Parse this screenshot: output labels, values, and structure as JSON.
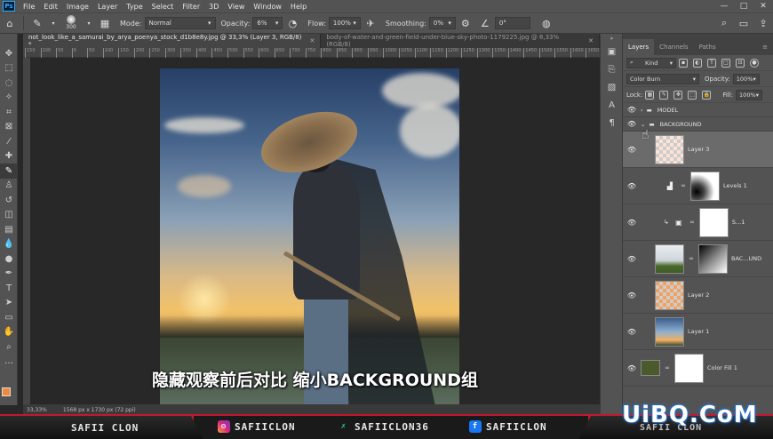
{
  "app": {
    "logo": "Ps",
    "menu": [
      "File",
      "Edit",
      "Image",
      "Layer",
      "Type",
      "Select",
      "Filter",
      "3D",
      "View",
      "Window",
      "Help"
    ],
    "window_controls": [
      "—",
      "□",
      "✕"
    ]
  },
  "options_bar": {
    "brush_size": "300",
    "mode_label": "Mode:",
    "mode_value": "Normal",
    "opacity_label": "Opacity:",
    "opacity_value": "6%",
    "flow_label": "Flow:",
    "flow_value": "100%",
    "smoothing_label": "Smoothing:",
    "smoothing_value": "0%",
    "angle_value": "0°"
  },
  "tabs": [
    {
      "label": "not_look_like_a_samurai_by_arya_poenya_stock_d1b8e8y.jpg @ 33,3% (Layer 3, RGB/8) *",
      "active": true
    },
    {
      "label": "body-of-water-and-green-field-under-blue-sky-photo-1179225.jpg @ 8,33% (RGB/8)",
      "active": false
    }
  ],
  "ruler": {
    "labels": [
      "150",
      "100",
      "50",
      "0",
      "50",
      "100",
      "150",
      "200",
      "250",
      "300",
      "350",
      "400",
      "450",
      "500",
      "550",
      "600",
      "650",
      "700",
      "750",
      "800",
      "850",
      "900",
      "950",
      "1000",
      "1050",
      "1100",
      "1150",
      "1200",
      "1250",
      "1300",
      "1350",
      "1400",
      "1450",
      "1500",
      "1550",
      "1600",
      "1650"
    ]
  },
  "status": {
    "zoom": "33,33%",
    "doc_size": "1568 px x 1730 px (72 ppi)"
  },
  "subtitle": "隐藏观察前后对比 缩小BACKGROUND组",
  "layers_panel": {
    "tabs": [
      "Layers",
      "Channels",
      "Paths"
    ],
    "kind_label": "Kind",
    "blend_mode": "Color Burn",
    "opacity_label": "Opacity:",
    "opacity_value": "100%",
    "lock_label": "Lock:",
    "fill_label": "Fill:",
    "fill_value": "100%",
    "layers": [
      {
        "name": "MODEL",
        "type": "group"
      },
      {
        "name": "BACKGROUND",
        "type": "group"
      },
      {
        "name": "Layer 3",
        "type": "pixel",
        "selected": true
      },
      {
        "name": "Levels 1",
        "type": "adjustment"
      },
      {
        "name": "S...1",
        "type": "adjustment"
      },
      {
        "name": "BAC...UND",
        "type": "masked"
      },
      {
        "name": "Layer 2",
        "type": "pixel"
      },
      {
        "name": "Layer 1",
        "type": "pixel"
      },
      {
        "name": "Color Fill 1",
        "type": "fill"
      }
    ]
  },
  "social": {
    "brand_left": "SAFII CLON",
    "instagram": "SAFIICLON",
    "twitter": "SAFIICLON36",
    "facebook": "SAFIICLON",
    "brand_right": "SAFII CLON"
  },
  "watermark": "UiBQ.CoM",
  "colors": {
    "foreground": "#f08a3c",
    "background": "#000000",
    "accent_red": "#c4182e"
  }
}
